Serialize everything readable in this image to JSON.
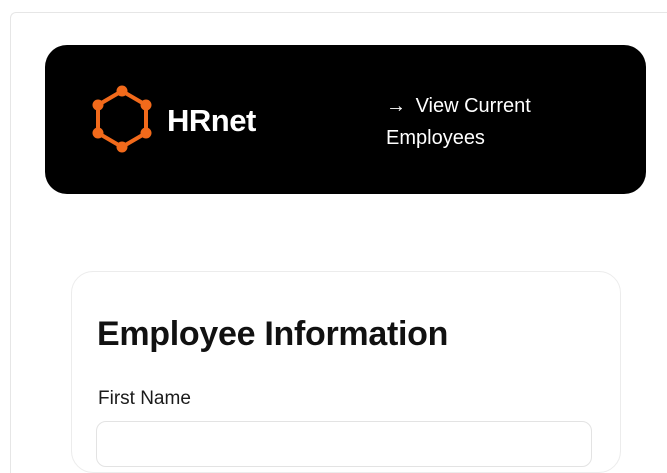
{
  "header": {
    "brand_name": "HRnet",
    "logo_icon": "hexagon-network-icon",
    "logo_color": "#f26a1b",
    "background_color": "#000000",
    "nav_link": {
      "arrow": "→",
      "label": "View Current Employees"
    }
  },
  "form": {
    "title": "Employee Information",
    "fields": [
      {
        "label": "First Name",
        "value": "",
        "placeholder": ""
      }
    ]
  }
}
